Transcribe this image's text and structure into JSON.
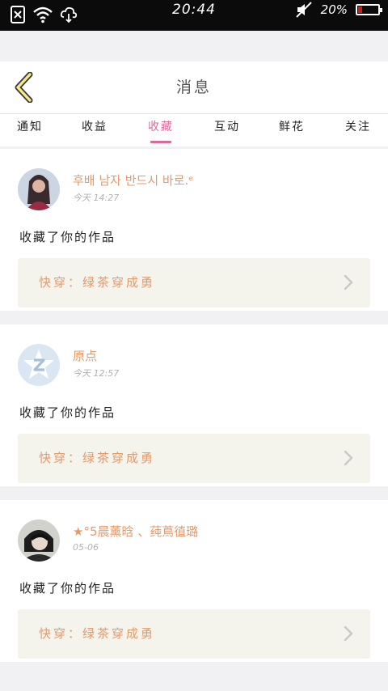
{
  "status_bar": {
    "time": "20:44",
    "battery_percent": "20%",
    "battery_level": 0.2,
    "icons": [
      "sim-off-icon",
      "wifi-icon",
      "cloud-icon",
      "mute-icon",
      "battery-icon"
    ]
  },
  "header": {
    "title": "消息",
    "back_icon": "chevron-left-icon"
  },
  "tabs": [
    {
      "label": "通知",
      "active": false
    },
    {
      "label": "收益",
      "active": false
    },
    {
      "label": "收藏",
      "active": true
    },
    {
      "label": "互动",
      "active": false
    },
    {
      "label": "鲜花",
      "active": false
    },
    {
      "label": "关注",
      "active": false
    }
  ],
  "notifications": [
    {
      "username": "후배 남자 반드시 바로.ᵉ",
      "time": "今天 14:27",
      "action": "收藏了你的作品",
      "work_title": "快穿：绿茶穿成勇",
      "avatar_icon": "user-photo-avatar"
    },
    {
      "username": "原点",
      "time": "今天 12:57",
      "action": "收藏了你的作品",
      "work_title": "快穿：绿茶穿成勇",
      "avatar_icon": "default-z-avatar"
    },
    {
      "username": "★°5晨薰晗 、莼蔦徝璐",
      "time": "05-06",
      "action": "收藏了你的作品",
      "work_title": "快穿：绿茶穿成勇",
      "avatar_icon": "user-photo-avatar"
    }
  ],
  "colors": {
    "accent_pink": "#d86a9c",
    "accent_orange": "#e59a6a",
    "background": "#f1f1f3",
    "work_box_bg": "#f4f3ec"
  }
}
